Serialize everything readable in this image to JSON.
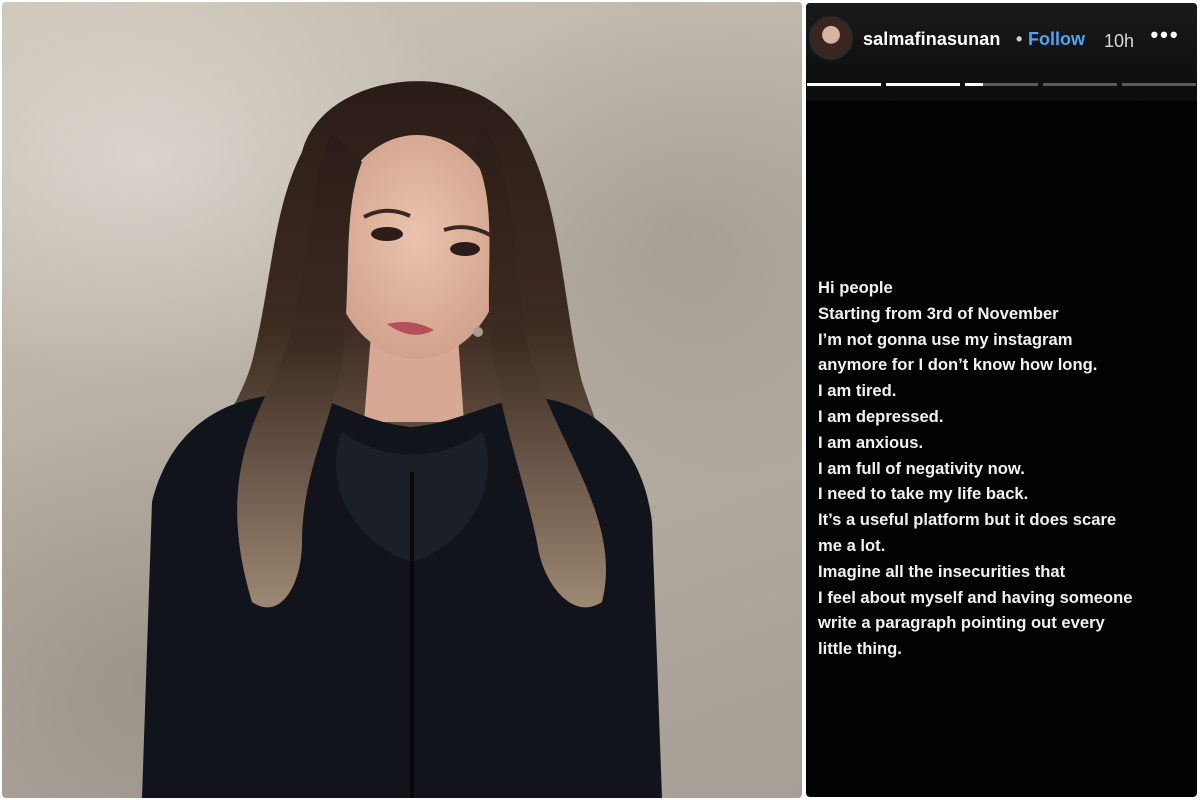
{
  "photo": {
    "colors": {
      "background": "#bcb3a8",
      "hair": "#3b2a22",
      "dress": "#11141a",
      "skin": "#ddb49f"
    }
  },
  "story": {
    "username": "salmafinasunan",
    "separator": "•",
    "follow_label": "Follow",
    "time": "10h",
    "more_label": "•••",
    "progress": [
      1,
      1,
      0.25,
      0,
      0
    ],
    "lines": [
      "Hi people",
      "Starting from 3rd of November",
      "I’m not  gonna use my instagram",
      "anymore for I don’t know how long.",
      "I am tired.",
      "I am depressed.",
      "I am anxious.",
      "I am full of negativity now.",
      "I need to take my life back.",
      "It’s a useful platform but it does scare",
      "me a lot.",
      "Imagine all the insecurities that",
      "I feel about myself and having someone",
      "write a paragraph pointing out every",
      "little thing."
    ],
    "colors": {
      "background": "#020202",
      "text": "#f2f2f2",
      "follow": "#4aa6f5"
    }
  }
}
